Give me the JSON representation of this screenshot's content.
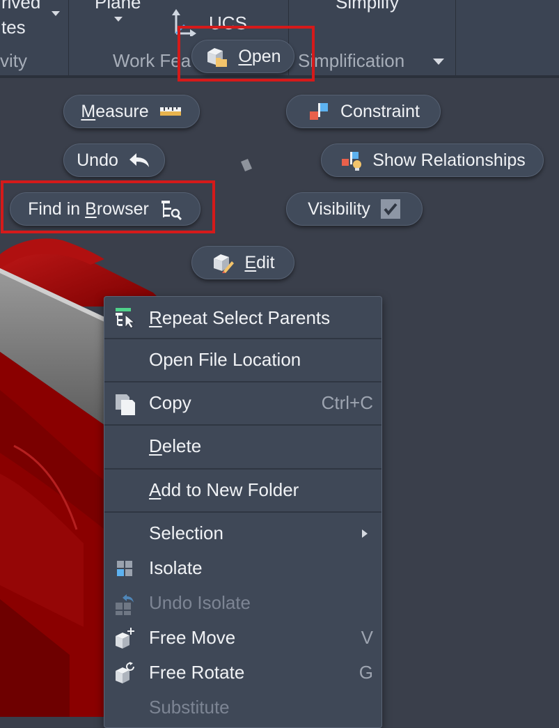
{
  "ribbon": {
    "derived_line1": "rived",
    "derived_line2": "tes",
    "plane_label": "Plane",
    "ucs_label": "UCS",
    "simplify_label": "Simplify",
    "panel_gravity": "vity",
    "panel_work_features": "Work Fea",
    "panel_simplification": "Simplification"
  },
  "marking_menu": {
    "open": {
      "pre": "",
      "ul": "O",
      "post": "pen"
    },
    "measure": {
      "pre": "",
      "ul": "M",
      "post": "easure"
    },
    "constraint": "Constraint",
    "undo": "Undo",
    "show_relationships": "Show Relationships",
    "find_in_browser": {
      "pre": "Find in ",
      "ul": "B",
      "post": "rowser"
    },
    "visibility": "Visibility",
    "edit": {
      "pre": "",
      "ul": "E",
      "post": "dit"
    }
  },
  "context_menu": {
    "repeat_select_parents": {
      "pre": "",
      "ul": "R",
      "post": "epeat Select Parents"
    },
    "open_file_location": "Open File Location",
    "copy": "Copy",
    "copy_shortcut": "Ctrl+C",
    "delete": {
      "pre": "",
      "ul": "D",
      "post": "elete"
    },
    "add_to_new_folder": {
      "pre": "",
      "ul": "A",
      "post": "dd to New Folder"
    },
    "selection": "Selection",
    "isolate": "Isolate",
    "undo_isolate": "Undo Isolate",
    "free_move": "Free Move",
    "free_move_shortcut": "V",
    "free_rotate": "Free Rotate",
    "free_rotate_shortcut": "G",
    "substitute": "Substitute"
  },
  "colors": {
    "background": "#3a3f4b",
    "ribbon": "#3b4453",
    "pill": "#414b5b",
    "menu": "#3f4857",
    "highlight_red": "#d51a1a",
    "part_red": "#8a0000"
  }
}
